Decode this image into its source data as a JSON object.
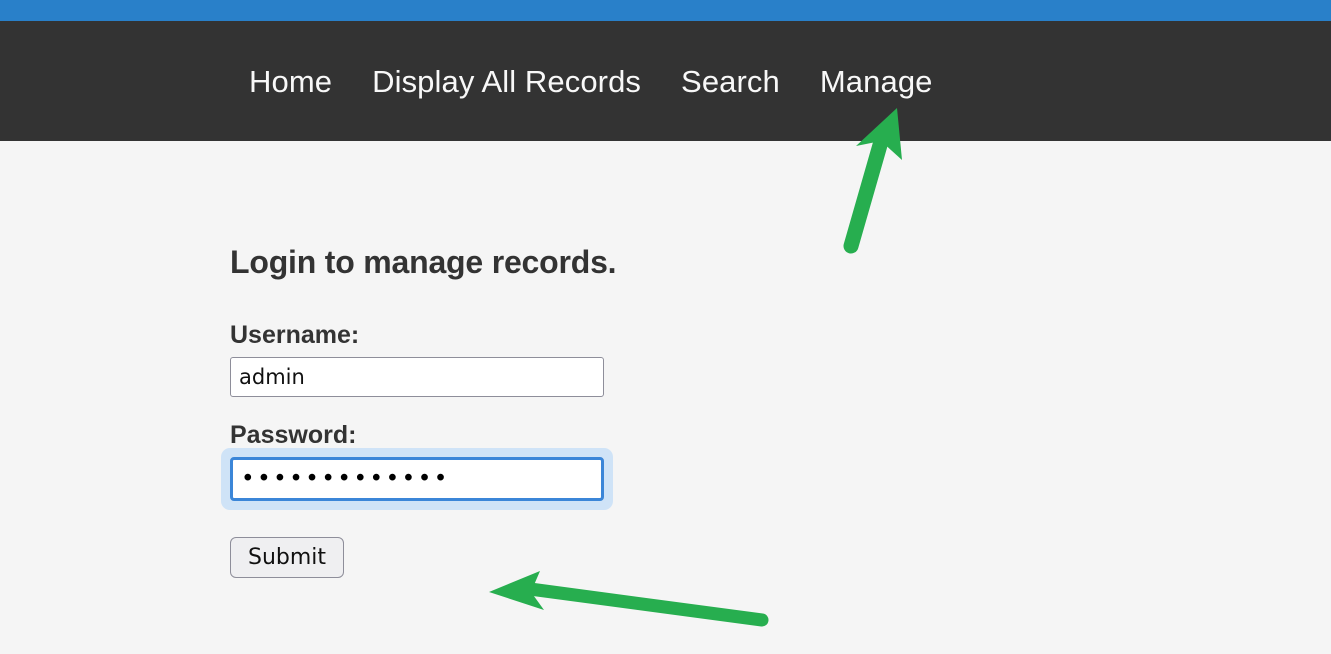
{
  "theme": {
    "accent_bar_color": "#2980c9",
    "navbar_color": "#333333",
    "page_background": "#f5f5f5",
    "focus_ring_color": "#3b86d8",
    "annotation_color": "#27ae4f"
  },
  "navbar": {
    "links": [
      {
        "label": "Home",
        "name": "nav-link-home"
      },
      {
        "label": "Display All Records",
        "name": "nav-link-display-all-records"
      },
      {
        "label": "Search",
        "name": "nav-link-search"
      },
      {
        "label": "Manage",
        "name": "nav-link-manage"
      }
    ]
  },
  "main": {
    "title": "Login to manage records.",
    "form": {
      "username": {
        "label": "Username:",
        "value": "admin",
        "placeholder": ""
      },
      "password": {
        "label": "Password:",
        "value": "•••••••••••••",
        "placeholder": "",
        "masked_character_count": 13,
        "focused": true
      },
      "submit_label": "Submit"
    }
  },
  "annotations": [
    {
      "name": "arrow-pointing-to-manage",
      "direction": "up-right",
      "target": "Manage"
    },
    {
      "name": "arrow-pointing-to-submit",
      "direction": "left",
      "target": "Submit"
    }
  ]
}
